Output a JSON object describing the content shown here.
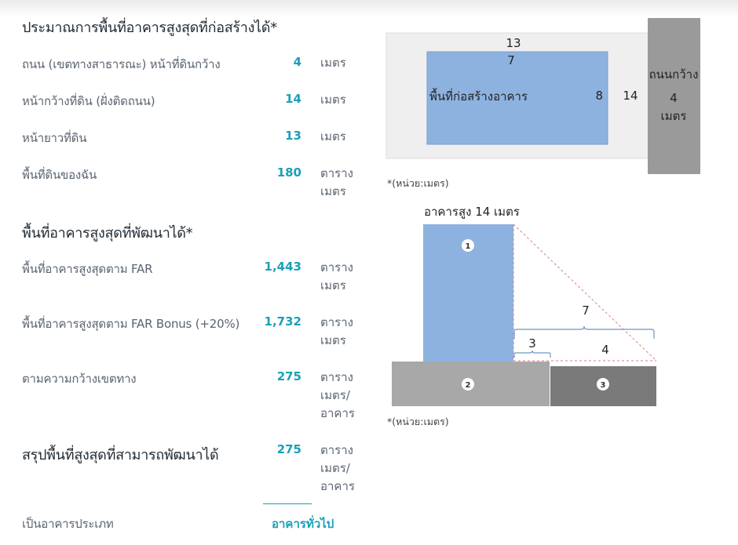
{
  "section1": {
    "title": "ประมาณการพื้นที่อาคารสูงสุดที่ก่อสร้างได้*",
    "rows": [
      {
        "label": "ถนน (เขตทางสาธารณะ) หน้าที่ดินกว้าง",
        "value": "4",
        "unit": "เมตร"
      },
      {
        "label": "หน้ากว้างที่ดิน (ฝั่งติดถนน)",
        "value": "14",
        "unit": "เมตร"
      },
      {
        "label": "หน้ายาวที่ดิน",
        "value": "13",
        "unit": "เมตร"
      },
      {
        "label": "พื้นที่ดินของฉัน",
        "value": "180",
        "unit_lines": [
          "ตาราง",
          "เมตร"
        ]
      }
    ]
  },
  "section2": {
    "title": "พื้นที่อาคารสูงสุดที่พัฒนาได้*",
    "rows": [
      {
        "label": "พื้นที่อาคารสูงสุดตาม FAR",
        "value": "1,443",
        "unit_lines": [
          "ตาราง",
          "เมตร"
        ]
      },
      {
        "label": "พื้นที่อาคารสูงสุดตาม FAR Bonus (+20%)",
        "value": "1,732",
        "unit_lines": [
          "ตาราง",
          "เมตร"
        ]
      },
      {
        "label": "ตามความกว้างเขตทาง",
        "value": "275",
        "unit_lines": [
          "ตาราง",
          "เมตร/",
          "อาคาร"
        ]
      }
    ]
  },
  "summary": {
    "title": "สรุปพื้นที่สูงสุดที่สามารถพัฒนาได้",
    "value": "275",
    "unit_lines": [
      "ตาราง",
      "เมตร/",
      "อาคาร"
    ]
  },
  "building_type": {
    "label": "เป็นอาคารประเภท",
    "value": "อาคารทั่วไป"
  },
  "plan_diagram": {
    "land_length": "13",
    "building_length": "7",
    "building_label": "พื้นที่ก่อสร้างอาคาร",
    "building_depth": "8",
    "land_width": "14",
    "road_label": "ถนนกว้าง",
    "road_width": "4",
    "road_unit": "เมตร",
    "note": "*(หน่วย:เมตร)",
    "colors": {
      "land": "#efefef",
      "building": "#8eb2e0",
      "road": "#9a9a9a"
    }
  },
  "section_diagram": {
    "height_label": "อาคารสูง 14 เมตร",
    "markers": [
      "1",
      "2",
      "3"
    ],
    "dim_total": "7",
    "dim_setback": "3",
    "dim_rest": "4",
    "note": "*(หน่วย:เมตร)",
    "colors": {
      "building": "#8eb2e0",
      "land": "#a8a8a8",
      "road": "#7a7a7a",
      "guide": "#e07a8a",
      "brace": "#6a96c8"
    }
  }
}
